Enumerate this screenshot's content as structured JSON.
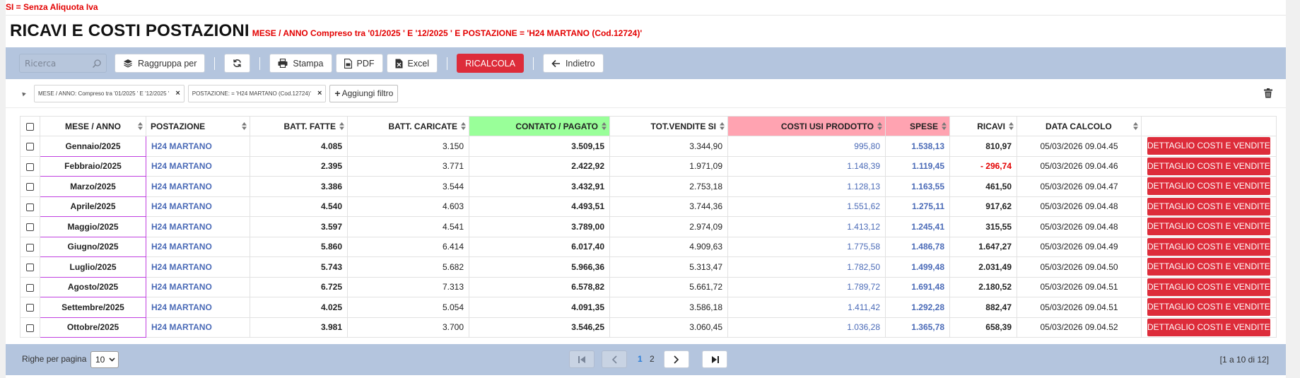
{
  "note": "SI = Senza Aliquota Iva",
  "page_title": "RICAVI E COSTI POSTAZIONI",
  "page_subtitle": "MESE / ANNO Compreso tra '01/2025 ' E '12/2025 ' E POSTAZIONE = 'H24 MARTANO (Cod.12724)'",
  "toolbar": {
    "search_placeholder": "Ricerca",
    "group_label": "Raggruppa per",
    "print_label": "Stampa",
    "pdf_label": "PDF",
    "excel_label": "Excel",
    "recalc_label": "RICALCOLA",
    "back_label": "Indietro"
  },
  "filters": {
    "chip1": "MESE / ANNO: Compreso tra '01/2025 ' E '12/2025 '",
    "chip2": "POSTAZIONE: = 'H24 MARTANO (Cod.12724)'",
    "add_label": "Aggiungi filtro"
  },
  "table": {
    "headers": {
      "mese": "MESE / ANNO",
      "postazione": "POSTAZIONE",
      "batt_fatte": "BATT. FATTE",
      "batt_caricate": "BATT. CARICATE",
      "contato": "CONTATO / PAGATO",
      "tot_vendite": "TOT.VENDITE SI",
      "costi": "COSTI USI PRODOTTO",
      "spese": "SPESE",
      "ricavi": "RICAVI",
      "data": "DATA CALCOLO"
    },
    "detail_button": "DETTAGLIO COSTI E VENDITE",
    "rows": [
      {
        "mese": "Gennaio/2025",
        "postazione": "H24 MARTANO",
        "batt_fatte": "4.085",
        "batt_caricate": "3.150",
        "contato": "3.509,15",
        "tot_vendite": "3.344,90",
        "costi": "995,80",
        "spese": "1.538,13",
        "ricavi": "810,97",
        "data": "05/03/2026 09.04.45"
      },
      {
        "mese": "Febbraio/2025",
        "postazione": "H24 MARTANO",
        "batt_fatte": "2.395",
        "batt_caricate": "3.771",
        "contato": "2.422,92",
        "tot_vendite": "1.971,09",
        "costi": "1.148,39",
        "spese": "1.119,45",
        "ricavi": "- 296,74",
        "data": "05/03/2026 09.04.46"
      },
      {
        "mese": "Marzo/2025",
        "postazione": "H24 MARTANO",
        "batt_fatte": "3.386",
        "batt_caricate": "3.544",
        "contato": "3.432,91",
        "tot_vendite": "2.753,18",
        "costi": "1.128,13",
        "spese": "1.163,55",
        "ricavi": "461,50",
        "data": "05/03/2026 09.04.47"
      },
      {
        "mese": "Aprile/2025",
        "postazione": "H24 MARTANO",
        "batt_fatte": "4.540",
        "batt_caricate": "4.603",
        "contato": "4.493,51",
        "tot_vendite": "3.744,36",
        "costi": "1.551,62",
        "spese": "1.275,11",
        "ricavi": "917,62",
        "data": "05/03/2026 09.04.48"
      },
      {
        "mese": "Maggio/2025",
        "postazione": "H24 MARTANO",
        "batt_fatte": "3.597",
        "batt_caricate": "4.541",
        "contato": "3.789,00",
        "tot_vendite": "2.974,09",
        "costi": "1.413,12",
        "spese": "1.245,41",
        "ricavi": "315,55",
        "data": "05/03/2026 09.04.48"
      },
      {
        "mese": "Giugno/2025",
        "postazione": "H24 MARTANO",
        "batt_fatte": "5.860",
        "batt_caricate": "6.414",
        "contato": "6.017,40",
        "tot_vendite": "4.909,63",
        "costi": "1.775,58",
        "spese": "1.486,78",
        "ricavi": "1.647,27",
        "data": "05/03/2026 09.04.49"
      },
      {
        "mese": "Luglio/2025",
        "postazione": "H24 MARTANO",
        "batt_fatte": "5.743",
        "batt_caricate": "5.682",
        "contato": "5.966,36",
        "tot_vendite": "5.313,47",
        "costi": "1.782,50",
        "spese": "1.499,48",
        "ricavi": "2.031,49",
        "data": "05/03/2026 09.04.50"
      },
      {
        "mese": "Agosto/2025",
        "postazione": "H24 MARTANO",
        "batt_fatte": "6.725",
        "batt_caricate": "7.313",
        "contato": "6.578,82",
        "tot_vendite": "5.661,72",
        "costi": "1.789,72",
        "spese": "1.691,48",
        "ricavi": "2.180,52",
        "data": "05/03/2026 09.04.51"
      },
      {
        "mese": "Settembre/2025",
        "postazione": "H24 MARTANO",
        "batt_fatte": "4.025",
        "batt_caricate": "5.054",
        "contato": "4.091,35",
        "tot_vendite": "3.586,18",
        "costi": "1.411,42",
        "spese": "1.292,28",
        "ricavi": "882,47",
        "data": "05/03/2026 09.04.51"
      },
      {
        "mese": "Ottobre/2025",
        "postazione": "H24 MARTANO",
        "batt_fatte": "3.981",
        "batt_caricate": "3.700",
        "contato": "3.546,25",
        "tot_vendite": "3.060,45",
        "costi": "1.036,28",
        "spese": "1.365,78",
        "ricavi": "658,39",
        "data": "05/03/2026 09.04.52"
      }
    ]
  },
  "footer": {
    "rows_per_page_label": "Righe per pagina",
    "rows_per_page_value": "10",
    "page1": "1",
    "page2": "2",
    "range": "[1 a 10 di 12]"
  },
  "colors": {
    "accent_red": "#dd2c3a",
    "toolbar_bg": "#b4c5de",
    "link_blue": "#4a6ab7",
    "contato_header": "#99ff99",
    "costi_header": "#ffa3b1"
  }
}
